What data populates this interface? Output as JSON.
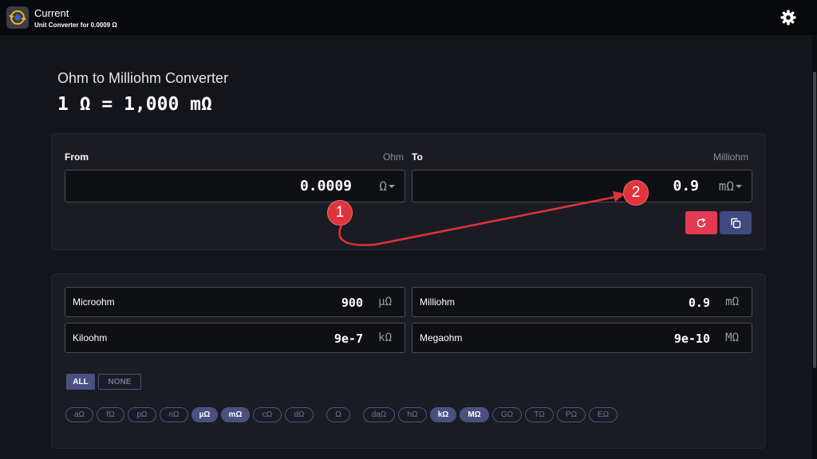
{
  "header": {
    "title": "Current",
    "subtitle": "Unit Converter for 0.0009 Ω"
  },
  "converter": {
    "title": "Ohm to Milliohm Converter",
    "equation": "1 Ω = 1,000 mΩ",
    "from": {
      "label": "From",
      "unit_name": "Ohm",
      "value": "0.0009",
      "unit": "Ω"
    },
    "to": {
      "label": "To",
      "unit_name": "Milliohm",
      "value": "0.9",
      "unit": "mΩ"
    }
  },
  "results": [
    {
      "name": "Microohm",
      "value": "900",
      "unit": "µΩ"
    },
    {
      "name": "Milliohm",
      "value": "0.9",
      "unit": "mΩ"
    },
    {
      "name": "Kiloohm",
      "value": "9e-7",
      "unit": "kΩ"
    },
    {
      "name": "Megaohm",
      "value": "9e-10",
      "unit": "MΩ"
    }
  ],
  "toggles": {
    "all": "ALL",
    "none": "NONE"
  },
  "units": [
    {
      "label": "aΩ",
      "selected": false
    },
    {
      "label": "fΩ",
      "selected": false
    },
    {
      "label": "pΩ",
      "selected": false
    },
    {
      "label": "nΩ",
      "selected": false
    },
    {
      "label": "µΩ",
      "selected": true
    },
    {
      "label": "mΩ",
      "selected": true
    },
    {
      "label": "cΩ",
      "selected": false
    },
    {
      "label": "dΩ",
      "selected": false
    },
    {
      "label": "Ω",
      "selected": false
    },
    {
      "label": "daΩ",
      "selected": false
    },
    {
      "label": "hΩ",
      "selected": false
    },
    {
      "label": "kΩ",
      "selected": true
    },
    {
      "label": "MΩ",
      "selected": true
    },
    {
      "label": "GΩ",
      "selected": false
    },
    {
      "label": "TΩ",
      "selected": false
    },
    {
      "label": "PΩ",
      "selected": false
    },
    {
      "label": "EΩ",
      "selected": false
    }
  ],
  "annotations": {
    "badge1": "1",
    "badge2": "2"
  },
  "colors": {
    "accent": "#4a5180",
    "reset": "#e23a52",
    "copy": "#3f4a80",
    "annotation": "#e0333c"
  },
  "icons": {
    "app": "clock-arrows-icon",
    "settings": "gear-icon",
    "reset": "refresh-icon",
    "copy": "copy-icon"
  }
}
